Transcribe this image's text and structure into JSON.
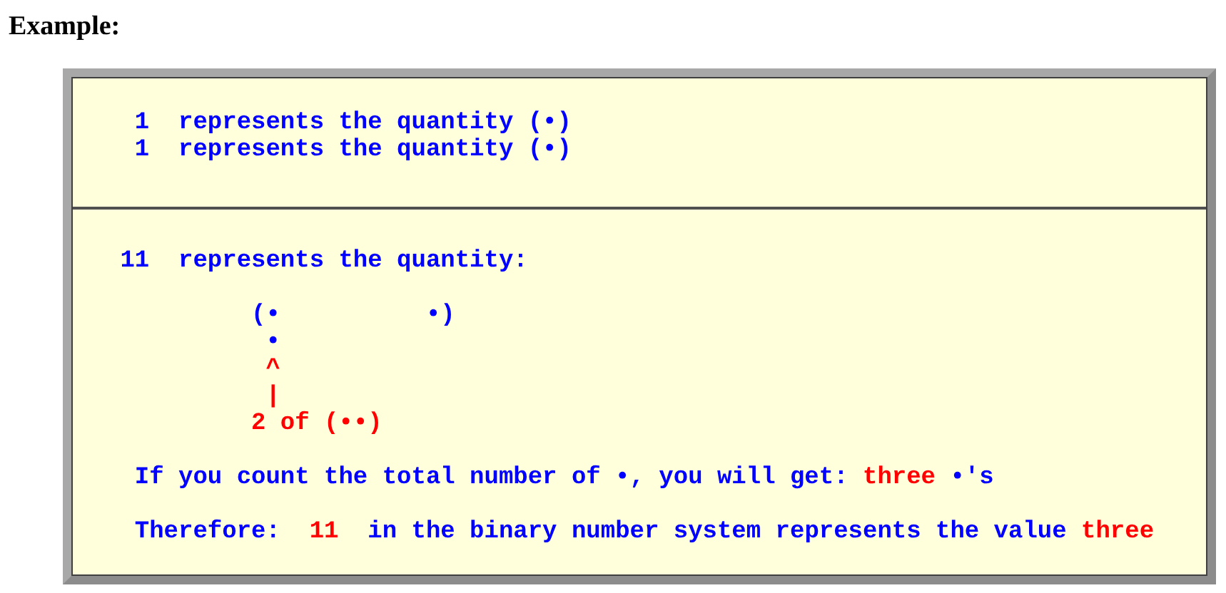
{
  "heading": "Example:",
  "box": {
    "top_lines": [
      [
        {
          "text": "  1  represents the quantity (•)",
          "color": "#0000ff"
        }
      ],
      [
        {
          "text": "  1  represents the quantity (•)",
          "color": "#0000ff"
        }
      ]
    ],
    "bottom_blocks": [
      [
        [
          {
            "text": " 11  represents the quantity:",
            "color": "#0000ff"
          }
        ]
      ],
      [
        [
          {
            "text": "          (•          •)",
            "color": "#0000ff"
          }
        ],
        [
          {
            "text": "           •",
            "color": "#0000ff"
          }
        ],
        [
          {
            "text": "           ^",
            "color": "#ff0000"
          }
        ],
        [
          {
            "text": "           |",
            "color": "#ff0000"
          }
        ],
        [
          {
            "text": "          2 of (••)",
            "color": "#ff0000"
          }
        ]
      ],
      [
        [
          {
            "text": "  If you count the total number of •, you will get: ",
            "color": "#0000ff"
          },
          {
            "text": "three",
            "color": "#ff0000"
          },
          {
            "text": " •'s",
            "color": "#0000ff"
          }
        ]
      ],
      [
        [
          {
            "text": "  Therefore:  ",
            "color": "#0000ff"
          },
          {
            "text": "11",
            "color": "#ff0000"
          },
          {
            "text": "  in the binary number system represents the value ",
            "color": "#0000ff"
          },
          {
            "text": "three",
            "color": "#ff0000"
          }
        ]
      ]
    ]
  }
}
